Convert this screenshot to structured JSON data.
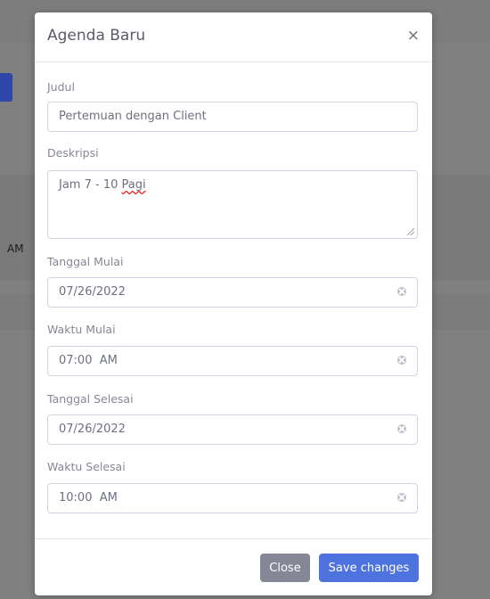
{
  "background": {
    "partial_text": "AM"
  },
  "modal": {
    "title": "Agenda Baru",
    "close_icon": "×",
    "fields": {
      "judul": {
        "label": "Judul",
        "value": "Pertemuan dengan Client"
      },
      "deskripsi": {
        "label": "Deskripsi",
        "value_prefix": "Jam 7 - 10 ",
        "value_misspelled": "Pagi"
      },
      "tanggal_mulai": {
        "label": "Tanggal Mulai",
        "value": "07/26/2022"
      },
      "waktu_mulai": {
        "label": "Waktu Mulai",
        "value": "07:00  AM"
      },
      "tanggal_selesai": {
        "label": "Tanggal Selesai",
        "value": "07/26/2022"
      },
      "waktu_selesai": {
        "label": "Waktu Selesai",
        "value": "10:00  AM"
      }
    },
    "footer": {
      "close_label": "Close",
      "save_label": "Save changes"
    }
  },
  "colors": {
    "primary": "#4e73df",
    "secondary": "#858796",
    "backdrop": "#808080"
  }
}
